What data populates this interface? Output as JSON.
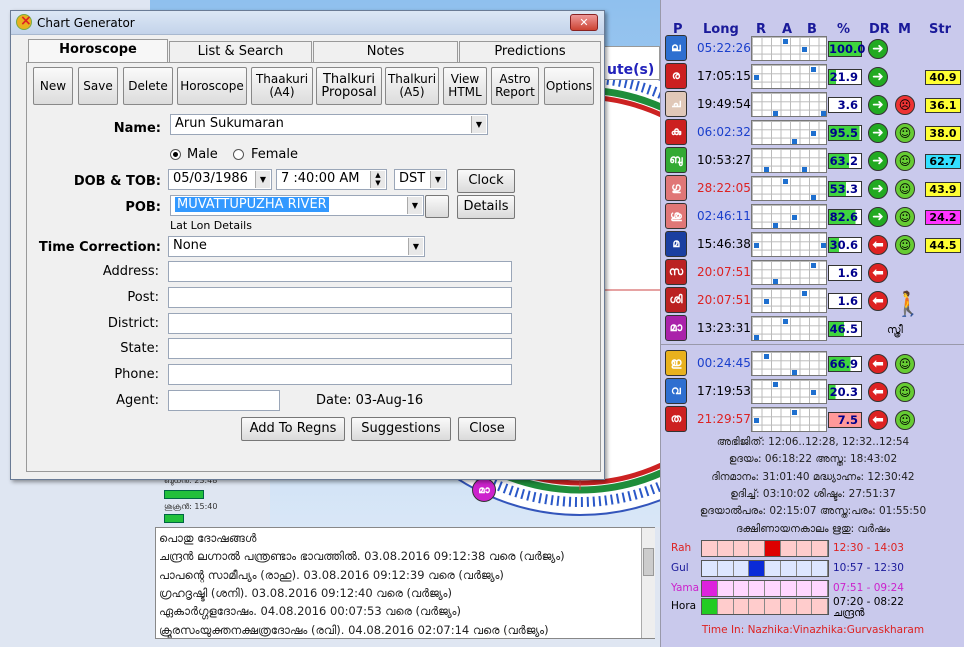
{
  "window": {
    "title": "Chart Generator"
  },
  "tabs": [
    {
      "label": "Horoscope",
      "active": true
    },
    {
      "label": "List & Search"
    },
    {
      "label": "Notes"
    },
    {
      "label": "Predictions"
    }
  ],
  "toolbar": {
    "new": "New",
    "save": "Save",
    "delete": "Delete",
    "horoscope": "Horoscope",
    "thaakuri": "Thaakuri\n(A4)",
    "thalkuri_proposal": "Thalkuri\nProposal",
    "thalkuri_a5": "Thalkuri\n(A5)",
    "view_html": "View\nHTML",
    "astro_report": "Astro\nReport",
    "options": "Options"
  },
  "form": {
    "name_label": "Name:",
    "name_value": "Arun Sukumaran",
    "male": "Male",
    "female": "Female",
    "dob_label": "DOB & TOB:",
    "dob": "05/03/1986",
    "tob": "7 :40:00 AM",
    "dst": "DST",
    "clock_btn": "Clock",
    "pob_label": "POB:",
    "pob": "MUVATTUPUZHA RIVER",
    "details_btn": "Details",
    "latlon": "Lat Lon Details",
    "timecorr_label": "Time Correction:",
    "timecorr": "None",
    "address_label": "Address:",
    "post_label": "Post:",
    "district_label": "District:",
    "state_label": "State:",
    "phone_label": "Phone:",
    "agent_label": "Agent:",
    "date_text": "Date: 03-Aug-16",
    "add_btn": "Add To Regns",
    "suggestions_btn": "Suggestions",
    "close_btn": "Close"
  },
  "background": {
    "header_fragment": "ute(s)",
    "chart_label": "മാ",
    "stat1": "ബുധന്‍: 23:48",
    "stat2": "ശുക്രന്‍: 15:40"
  },
  "dosha": {
    "lines": [
      "പൊതു ദോഷങ്ങള്‍",
      "ചന്ദ്രന്‍ ലഗ്നാല്‍ പന്ത്രണ്ടാം ഭാവത്തില്‍. 03.08.2016 09:12:38 വരെ (വര്‍ജ്യം)",
      "പാപന്റെ സാമീപ്യം (രാഹു). 03.08.2016 09:12:39 വരെ (വര്‍ജ്യം)",
      "ഗ്രഹദൃഷ്ടി (ശനി). 03.08.2016 09:12:40 വരെ (വര്‍ജ്യം)",
      "ഏകാര്‍ഗ്ഗളദോഷം. 04.08.2016 00:07:53 വരെ (വര്‍ജ്യം)",
      "ക്രൂരസംയുക്തനക്ഷത്രദോഷം (രവി). 04.08.2016 02:07:14 വരെ (വര്‍ജ്യം)"
    ]
  },
  "planet_table": {
    "headers": [
      "P",
      "Long",
      "R",
      "A",
      "B",
      "%",
      "DR",
      "M",
      "Str"
    ],
    "rows": [
      {
        "p": "ല",
        "color": "#2e6fd0",
        "long": "05:22:26",
        "long_color": "#1a3fcc",
        "pct": "100.0",
        "pct_bg": "#3fd43f",
        "dr": "green",
        "m": "",
        "str": "",
        "str_bg": ""
      },
      {
        "p": "ര",
        "color": "#cc2020",
        "long": "17:05:15",
        "long_color": "#000000",
        "pct": "21.9",
        "pct_bg": "#3fd43f",
        "dr": "green",
        "m": "",
        "str": "40.9",
        "str_bg": "#ffff33"
      },
      {
        "p": "ച",
        "color": "#e0c8b8",
        "long": "19:49:54",
        "long_color": "#000000",
        "pct": "3.6",
        "pct_bg": "#ffffff",
        "dr": "green",
        "m": "angry",
        "str": "36.1",
        "str_bg": "#ffff33"
      },
      {
        "p": "കു",
        "color": "#cc2020",
        "long": "06:02:32",
        "long_color": "#1a3fcc",
        "pct": "95.5",
        "pct_bg": "#3fd43f",
        "dr": "green",
        "m": "happy",
        "str": "38.0",
        "str_bg": "#ffff33"
      },
      {
        "p": "ബു",
        "color": "#33aa33",
        "long": "10:53:27",
        "long_color": "#000000",
        "pct": "63.2",
        "pct_bg": "#3fd43f",
        "dr": "green",
        "m": "happy",
        "str": "62.7",
        "str_bg": "#33e0ff"
      },
      {
        "p": "ഗു",
        "color": "#e07777",
        "long": "28:22:05",
        "long_color": "#dd2222",
        "pct": "53.3",
        "pct_bg": "#3fd43f",
        "dr": "green",
        "m": "happy",
        "str": "43.9",
        "str_bg": "#ffff33"
      },
      {
        "p": "ശു",
        "color": "#e07777",
        "long": "02:46:11",
        "long_color": "#1a3fcc",
        "pct": "82.6",
        "pct_bg": "#3fd43f",
        "dr": "green",
        "m": "happy",
        "str": "24.2",
        "str_bg": "#ff33ff"
      },
      {
        "p": "മ",
        "color": "#1a3fa0",
        "long": "15:46:38",
        "long_color": "#000000",
        "pct": "30.6",
        "pct_bg": "#3fd43f",
        "dr": "red",
        "m": "happy",
        "str": "44.5",
        "str_bg": "#ffff33"
      },
      {
        "p": "സ",
        "color": "#bb2222",
        "long": "20:07:51",
        "long_color": "#dd2222",
        "pct": "1.6",
        "pct_bg": "#ffffff",
        "dr": "red",
        "m": "",
        "str": "",
        "str_bg": ""
      },
      {
        "p": "ശി",
        "color": "#bb2222",
        "long": "20:07:51",
        "long_color": "#dd2222",
        "pct": "1.6",
        "pct_bg": "#ffffff",
        "dr": "red",
        "m": "",
        "str": "",
        "str_bg": ""
      },
      {
        "p": "മാ",
        "color": "#aa22aa",
        "long": "13:23:31",
        "long_color": "#000000",
        "pct": "46.5",
        "pct_bg": "#3fd43f",
        "dr": "",
        "m": "",
        "str": "",
        "str_bg": ""
      },
      {
        "p": "ഇ",
        "color": "#e8b11e",
        "long": "00:24:45",
        "long_color": "#1a3fcc",
        "pct": "66.9",
        "pct_bg": "#3fd43f",
        "dr": "red",
        "m": "happy",
        "str": "",
        "str_bg": ""
      },
      {
        "p": "വ",
        "color": "#2e6fd0",
        "long": "17:19:53",
        "long_color": "#000000",
        "pct": "20.3",
        "pct_bg": "#3fd43f",
        "dr": "red",
        "m": "happy",
        "str": "",
        "str_bg": ""
      },
      {
        "p": "ത",
        "color": "#cc2020",
        "long": "21:29:57",
        "long_color": "#dd2222",
        "pct": "7.5",
        "pct_bg": "#ff9999",
        "dr": "red",
        "m": "happy",
        "str": "",
        "str_bg": ""
      }
    ],
    "female_label": "സ്ത്രീ"
  },
  "day_info": [
    "അഭിജിത്: 12:06..12:28, 12:32..12:54",
    "ഉദയം: 06:18:22  അസ്ത: 18:43:02",
    "ദിനമാനം: 31:01:40  മദ്ധ്യാഹ്നം: 12:30:42",
    "ഉദിച്ച്: 03:10:02  ശിഷ്ടം: 27:51:37",
    "ഉദയാല്‍പരം: 02:15:07  അസ്ത:പരം: 01:55:50",
    "ദക്ഷിണായനകാലം ഋതു: വര്‍ഷം"
  ],
  "time_rows": [
    {
      "label": "Rah",
      "color": "#dd2222",
      "time": "12:30 - 14:03",
      "cells_bg": "#ffcccc",
      "mark_index": 4,
      "mark_color": "#dd0000"
    },
    {
      "label": "Gul",
      "color": "#1a1a9a",
      "time": "10:57 - 12:30",
      "cells_bg": "#dde6ff",
      "mark_index": 3,
      "mark_color": "#0a2ad8"
    },
    {
      "label": "Yama",
      "color": "#cc22cc",
      "time": "07:51 - 09:24",
      "cells_bg": "#ffd6ff",
      "mark_index": 0,
      "mark_color": "#dd22dd"
    },
    {
      "label": "Hora",
      "color": "#000000",
      "time": "07:20 - 08:22",
      "time2": "ചന്ദ്രന്‍",
      "cells_bg": "#ffcccc",
      "mark_index": 0,
      "mark_color": "#22cc22"
    }
  ],
  "footer": "Time In: Nazhika:Vinazhika:Gurvaskharam"
}
